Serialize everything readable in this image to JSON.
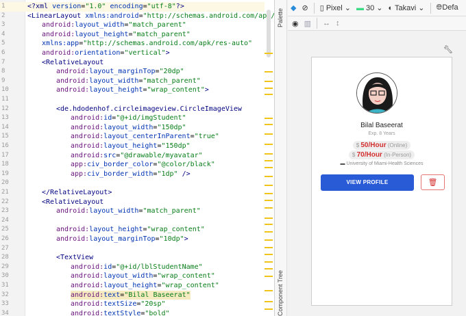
{
  "editor": {
    "lines": [
      {
        "n": "1",
        "ind": 0,
        "parts": [
          [
            "t",
            "<?xml "
          ],
          [
            "n",
            "version"
          ],
          [
            "p",
            "="
          ],
          [
            "s",
            "\"1.0\" "
          ],
          [
            "n",
            "encoding"
          ],
          [
            "p",
            "="
          ],
          [
            "s",
            "\"utf-8\""
          ],
          [
            "t",
            "?>"
          ]
        ]
      },
      {
        "n": "2",
        "ind": 0,
        "parts": [
          [
            "t",
            "<LinearLayout "
          ],
          [
            "n",
            "xmlns:android"
          ],
          [
            "p",
            "="
          ],
          [
            "s",
            "\"http://schemas.android.com/apk/res/andr"
          ]
        ]
      },
      {
        "n": "3",
        "ind": 1,
        "parts": [
          [
            "a",
            "android:"
          ],
          [
            "n",
            "layout_width"
          ],
          [
            "p",
            "="
          ],
          [
            "s",
            "\"match_parent\""
          ]
        ]
      },
      {
        "n": "4",
        "ind": 1,
        "parts": [
          [
            "a",
            "android:"
          ],
          [
            "n",
            "layout_height"
          ],
          [
            "p",
            "="
          ],
          [
            "s",
            "\"match_parent\""
          ]
        ]
      },
      {
        "n": "5",
        "ind": 1,
        "parts": [
          [
            "n",
            "xmlns:app"
          ],
          [
            "p",
            "="
          ],
          [
            "s",
            "\"http://schemas.android.com/apk/res-auto\""
          ]
        ]
      },
      {
        "n": "6",
        "ind": 1,
        "parts": [
          [
            "a",
            "android:"
          ],
          [
            "n",
            "orientation"
          ],
          [
            "p",
            "="
          ],
          [
            "s",
            "\"vertical\""
          ],
          [
            "t",
            ">"
          ]
        ]
      },
      {
        "n": "7",
        "ind": 1,
        "parts": [
          [
            "t",
            "<RelativeLayout"
          ]
        ]
      },
      {
        "n": "8",
        "ind": 2,
        "parts": [
          [
            "a",
            "android:"
          ],
          [
            "n",
            "layout_marginTop"
          ],
          [
            "p",
            "="
          ],
          [
            "s",
            "\"20dp\""
          ]
        ]
      },
      {
        "n": "9",
        "ind": 2,
        "parts": [
          [
            "a",
            "android:"
          ],
          [
            "n",
            "layout_width"
          ],
          [
            "p",
            "="
          ],
          [
            "s",
            "\"match_parent\""
          ]
        ]
      },
      {
        "n": "10",
        "ind": 2,
        "parts": [
          [
            "a",
            "android:"
          ],
          [
            "n",
            "layout_height"
          ],
          [
            "p",
            "="
          ],
          [
            "s",
            "\"wrap_content\""
          ],
          [
            "t",
            ">"
          ]
        ]
      },
      {
        "n": "11",
        "ind": 0,
        "parts": []
      },
      {
        "n": "12",
        "ind": 2,
        "parts": [
          [
            "t",
            "<de.hdodenhof.circleimageview.CircleImageView"
          ]
        ]
      },
      {
        "n": "13",
        "ind": 3,
        "parts": [
          [
            "a",
            "android:"
          ],
          [
            "n",
            "id"
          ],
          [
            "p",
            "="
          ],
          [
            "s",
            "\"@+id/imgStudent\""
          ]
        ]
      },
      {
        "n": "14",
        "ind": 3,
        "parts": [
          [
            "a",
            "android:"
          ],
          [
            "n",
            "layout_width"
          ],
          [
            "p",
            "="
          ],
          [
            "s",
            "\"150dp\""
          ]
        ]
      },
      {
        "n": "15",
        "ind": 3,
        "parts": [
          [
            "a",
            "android:"
          ],
          [
            "n",
            "layout_centerInParent"
          ],
          [
            "p",
            "="
          ],
          [
            "s",
            "\"true\""
          ]
        ]
      },
      {
        "n": "16",
        "ind": 3,
        "parts": [
          [
            "a",
            "android:"
          ],
          [
            "n",
            "layout_height"
          ],
          [
            "p",
            "="
          ],
          [
            "s",
            "\"150dp\""
          ]
        ]
      },
      {
        "n": "17",
        "ind": 3,
        "parts": [
          [
            "a",
            "android:"
          ],
          [
            "n",
            "src"
          ],
          [
            "p",
            "="
          ],
          [
            "s",
            "\"@drawable/myavatar\""
          ]
        ]
      },
      {
        "n": "18",
        "ind": 3,
        "parts": [
          [
            "a",
            "app:"
          ],
          [
            "n",
            "civ_border_color"
          ],
          [
            "p",
            "="
          ],
          [
            "s",
            "\"@color/black\""
          ]
        ]
      },
      {
        "n": "19",
        "ind": 3,
        "parts": [
          [
            "a",
            "app:"
          ],
          [
            "n",
            "civ_border_width"
          ],
          [
            "p",
            "="
          ],
          [
            "s",
            "\"1dp\""
          ],
          [
            "t",
            " />"
          ]
        ]
      },
      {
        "n": "20",
        "ind": 0,
        "parts": []
      },
      {
        "n": "21",
        "ind": 1,
        "parts": [
          [
            "t",
            "</RelativeLayout>"
          ]
        ]
      },
      {
        "n": "22",
        "ind": 1,
        "parts": [
          [
            "t",
            "<RelativeLayout"
          ]
        ]
      },
      {
        "n": "23",
        "ind": 2,
        "parts": [
          [
            "a",
            "android:"
          ],
          [
            "n",
            "layout_width"
          ],
          [
            "p",
            "="
          ],
          [
            "s",
            "\"match_parent\""
          ]
        ]
      },
      {
        "n": "24",
        "ind": 0,
        "parts": []
      },
      {
        "n": "25",
        "ind": 2,
        "parts": [
          [
            "a",
            "android:"
          ],
          [
            "n",
            "layout_height"
          ],
          [
            "p",
            "="
          ],
          [
            "s",
            "\"wrap_content\""
          ]
        ]
      },
      {
        "n": "26",
        "ind": 2,
        "parts": [
          [
            "a",
            "android:"
          ],
          [
            "n",
            "layout_marginTop"
          ],
          [
            "p",
            "="
          ],
          [
            "s",
            "\"10dp\""
          ],
          [
            "t",
            ">"
          ]
        ]
      },
      {
        "n": "27",
        "ind": 0,
        "parts": []
      },
      {
        "n": "28",
        "ind": 2,
        "parts": [
          [
            "t",
            "<TextView"
          ]
        ]
      },
      {
        "n": "29",
        "ind": 3,
        "parts": [
          [
            "a",
            "android:"
          ],
          [
            "n",
            "id"
          ],
          [
            "p",
            "="
          ],
          [
            "s",
            "\"@+id/lblStudentName\""
          ]
        ]
      },
      {
        "n": "30",
        "ind": 3,
        "parts": [
          [
            "a",
            "android:"
          ],
          [
            "n",
            "layout_width"
          ],
          [
            "p",
            "="
          ],
          [
            "s",
            "\"wrap_content\""
          ]
        ]
      },
      {
        "n": "31",
        "ind": 3,
        "parts": [
          [
            "a",
            "android:"
          ],
          [
            "n",
            "layout_height"
          ],
          [
            "p",
            "="
          ],
          [
            "s",
            "\"wrap_content\""
          ]
        ]
      },
      {
        "n": "32",
        "ind": 3,
        "hl": true,
        "parts": [
          [
            "a",
            "android:"
          ],
          [
            "n",
            "text"
          ],
          [
            "p",
            "="
          ],
          [
            "s",
            "\"Bilal Baseerat\""
          ]
        ]
      },
      {
        "n": "33",
        "ind": 3,
        "parts": [
          [
            "a",
            "android:"
          ],
          [
            "n",
            "textSize"
          ],
          [
            "p",
            "="
          ],
          [
            "s",
            "\"20sp\""
          ]
        ]
      },
      {
        "n": "34",
        "ind": 3,
        "parts": [
          [
            "a",
            "android:"
          ],
          [
            "n",
            "textStyle"
          ],
          [
            "p",
            "="
          ],
          [
            "s",
            "\"bold\""
          ]
        ]
      }
    ]
  },
  "side": {
    "palette": "Palette",
    "component_tree": "Component Tree"
  },
  "toolbar": {
    "device": "Pixel",
    "api": "30",
    "theme": "Takavi",
    "locale": "Defa"
  },
  "preview": {
    "name": "Bilal Baseerat",
    "experience": "Exp. 8 Years",
    "currency": "$",
    "rate_online": "50/Hour",
    "online_label": "(Online)",
    "rate_inperson": "70/Hour",
    "inperson_label": "(In-Person)",
    "university": "University of Miami-Health Sciences",
    "view_profile": "VIEW PROFILE"
  },
  "colors": {
    "accent": "#2a5bd7",
    "price": "#d32f2f"
  }
}
